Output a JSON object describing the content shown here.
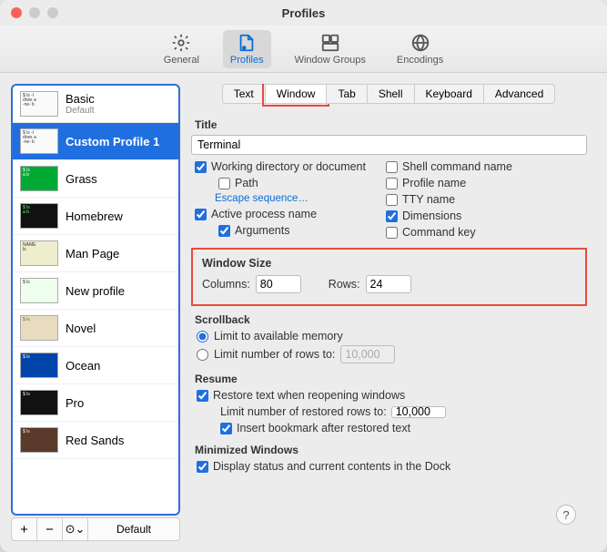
{
  "window": {
    "title": "Profiles"
  },
  "toolbar": [
    {
      "label": "General",
      "icon": "gear-icon"
    },
    {
      "label": "Profiles",
      "icon": "profile-icon",
      "active": true
    },
    {
      "label": "Window Groups",
      "icon": "window-groups-icon"
    },
    {
      "label": "Encodings",
      "icon": "globe-icon"
    }
  ],
  "profiles": [
    {
      "name": "Basic",
      "subtitle": "Default",
      "thumb": "light"
    },
    {
      "name": "Custom Profile 1",
      "thumb": "light",
      "selected": true
    },
    {
      "name": "Grass",
      "thumb": "green"
    },
    {
      "name": "Homebrew",
      "thumb": "dark"
    },
    {
      "name": "Man Page",
      "thumb": "yellow"
    },
    {
      "name": "New profile",
      "thumb": "light"
    },
    {
      "name": "Novel",
      "thumb": "novel"
    },
    {
      "name": "Ocean",
      "thumb": "blue"
    },
    {
      "name": "Pro",
      "thumb": "dark"
    },
    {
      "name": "Red Sands",
      "thumb": "brown"
    }
  ],
  "sidebarFooter": {
    "add": "+",
    "remove": "−",
    "menu": "⊙⌄",
    "default": "Default"
  },
  "tabs": [
    "Text",
    "Window",
    "Tab",
    "Shell",
    "Keyboard",
    "Advanced"
  ],
  "activeTab": 1,
  "title": {
    "label": "Title",
    "value": "Terminal",
    "opts": {
      "workingDir": {
        "label": "Working directory or document",
        "checked": true
      },
      "path": {
        "label": "Path",
        "checked": false
      },
      "escape": "Escape sequence…",
      "activeProcess": {
        "label": "Active process name",
        "checked": true
      },
      "arguments": {
        "label": "Arguments",
        "checked": true
      },
      "shellCmd": {
        "label": "Shell command name",
        "checked": false
      },
      "profileName": {
        "label": "Profile name",
        "checked": false
      },
      "ttyName": {
        "label": "TTY name",
        "checked": false
      },
      "dimensions": {
        "label": "Dimensions",
        "checked": true
      },
      "commandKey": {
        "label": "Command key",
        "checked": false
      }
    }
  },
  "windowSize": {
    "label": "Window Size",
    "columnsLabel": "Columns:",
    "columns": "80",
    "rowsLabel": "Rows:",
    "rows": "24"
  },
  "scrollback": {
    "label": "Scrollback",
    "limitMem": "Limit to available memory",
    "limitRows": "Limit number of rows to:",
    "limitRowsValue": "10,000",
    "selected": "mem"
  },
  "resume": {
    "label": "Resume",
    "restoreText": {
      "label": "Restore text when reopening windows",
      "checked": true
    },
    "limitRowsLabel": "Limit number of restored rows to:",
    "limitRowsValue": "10,000",
    "insertBookmark": {
      "label": "Insert bookmark after restored text",
      "checked": true
    }
  },
  "minimized": {
    "label": "Minimized Windows",
    "displayDock": {
      "label": "Display status and current contents in the Dock",
      "checked": true
    }
  },
  "help": "?"
}
